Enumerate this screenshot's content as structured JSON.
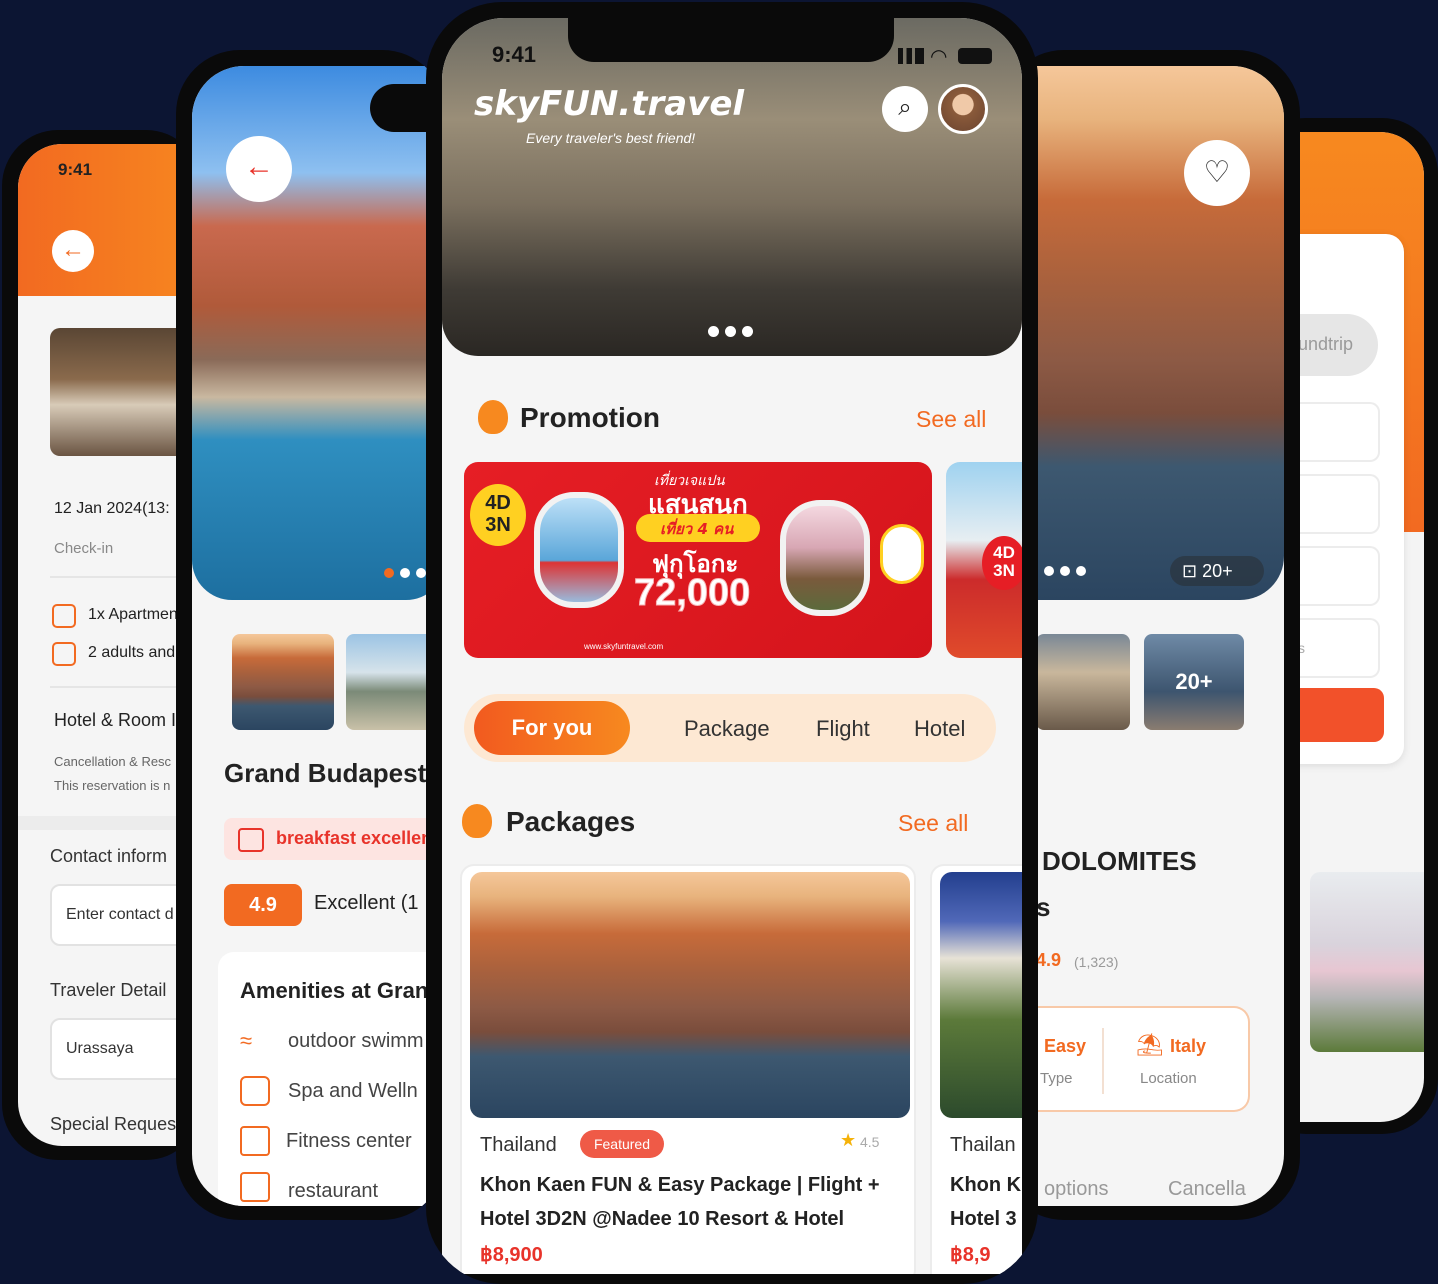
{
  "phone1": {
    "time": "9:41",
    "checkin_date": "12 Jan 2024(13:",
    "checkin_label": "Check-in",
    "room": "1x Apartmen",
    "guests": "2 adults and",
    "section_title": "Hotel & Room I",
    "cancel_line1": "Cancellation & Resc",
    "cancel_line2": "This reservation is n",
    "contact_label": "Contact inform",
    "contact_placeholder": "Enter contact d",
    "traveler_label": "Traveler Detail",
    "traveler_value": "Urassaya",
    "special_label": "Special Reques"
  },
  "phone2": {
    "hotel_name": "Grand Budapest",
    "tag": "breakfast excellen",
    "rating": "4.9",
    "rating_text": "Excellent (1",
    "amenities_title": "Amenities at Gran",
    "amenities": [
      "outdoor swimm",
      "Spa and Welln",
      "Fitness center",
      "restaurant"
    ]
  },
  "phone3": {
    "time": "9:41",
    "logo": "skyFUN.travel",
    "tagline": "Every traveler's best friend!",
    "promotion_title": "Promotion",
    "see_all": "See all",
    "promo_banner": {
      "days": "4D",
      "nights": "3N",
      "line1": "เที่ยวเจแปน",
      "line2": "แสนสนุก",
      "line3": "เที่ยว 4 คน",
      "city": "ฟุกุโอกะ",
      "price": "72,000",
      "footer": "www.skyfuntravel.com"
    },
    "tabs": [
      "For you",
      "Package",
      "Flight",
      "Hotel"
    ],
    "packages_title": "Packages",
    "packages_see_all": "See all",
    "package": {
      "country": "Thailand",
      "badge": "Featured",
      "rating": "4.5",
      "title_line1": "Khon Kaen FUN & Easy Package | Flight +",
      "title_line2": "Hotel 3D2N @Nadee 10 Resort & Hotel",
      "price": "฿8,900"
    },
    "package2": {
      "country": "Thailan",
      "title_line1": "Khon K",
      "title_line2": "Hotel 3",
      "price": "฿8,9"
    }
  },
  "phone4": {
    "photo_count": "20+",
    "thumb_count": "20+",
    "title": "DOLOMITES",
    "subtitle": "s",
    "rating": "4.9",
    "reviews": "(1,323)",
    "type_value": "Easy",
    "type_label": "Type",
    "location_value": "Italy",
    "location_label": "Location",
    "tab_options": "options",
    "tab_cancel": "Cancella"
  },
  "phone5": {
    "trip_toggle": "undtrip",
    "field_hint": "s"
  },
  "colors": {
    "background": "#0c1533",
    "accent": "#f26a21",
    "red": "#ee3a2c"
  }
}
